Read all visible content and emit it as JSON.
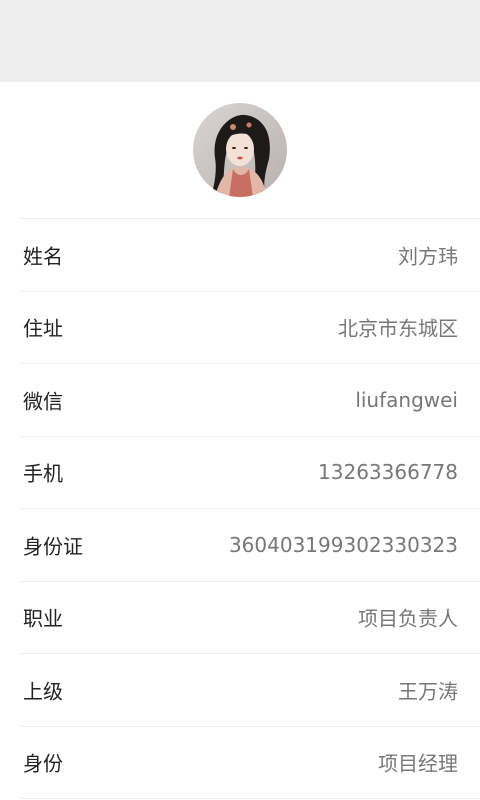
{
  "colors": {
    "topbar": "#eeeeee",
    "label": "#222222",
    "value": "#777777",
    "divider": "#ececec"
  },
  "profile": {
    "avatar_icon": "profile-photo",
    "fields": [
      {
        "label": "姓名",
        "value": "刘方玮"
      },
      {
        "label": "住址",
        "value": "北京市东城区"
      },
      {
        "label": "微信",
        "value": "liufangwei"
      },
      {
        "label": "手机",
        "value": "13263366778"
      },
      {
        "label": "身份证",
        "value": "360403199302330323"
      },
      {
        "label": "职业",
        "value": "项目负责人"
      },
      {
        "label": "上级",
        "value": "王万涛"
      },
      {
        "label": "身份",
        "value": "项目经理"
      }
    ]
  }
}
